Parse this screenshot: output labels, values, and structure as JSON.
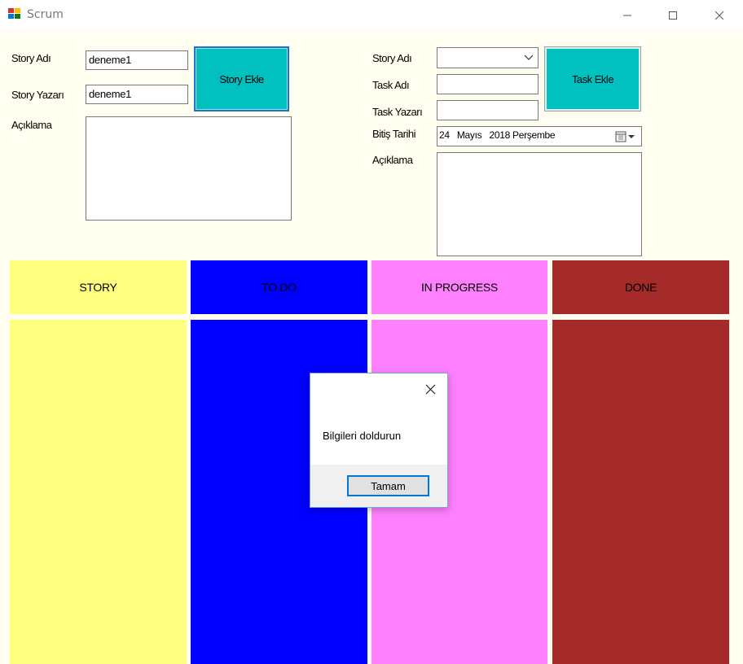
{
  "window": {
    "title": "Scrum",
    "minimize_glyph": "—",
    "maximize_glyph": "☐",
    "close_glyph": "✕"
  },
  "story_form": {
    "name_label": "Story Adı",
    "name_value": "deneme1",
    "author_label": "Story Yazarı",
    "author_value": "deneme1",
    "description_label": "Açıklama",
    "description_value": "",
    "add_button": "Story Ekle"
  },
  "task_form": {
    "story_label": "Story Adı",
    "story_value": "",
    "task_name_label": "Task Adı",
    "task_name_value": "",
    "task_author_label": "Task Yazarı",
    "task_author_value": "",
    "due_date_label": "Bitiş Tarihi",
    "due_date_value": "24   Mayıs   2018 Perşembe",
    "description_label": "Açıklama",
    "description_value": "",
    "add_button": "Task Ekle"
  },
  "board": {
    "columns": [
      {
        "label": "STORY",
        "color": "#ffff80"
      },
      {
        "label": "TO DO",
        "color": "#0000ff"
      },
      {
        "label": "IN PROGRESS",
        "color": "#ff80ff"
      },
      {
        "label": "DONE",
        "color": "#a52a2a"
      }
    ]
  },
  "dialog": {
    "message": "Bilgileri doldurun",
    "ok_button": "Tamam",
    "close_glyph": "✕"
  }
}
